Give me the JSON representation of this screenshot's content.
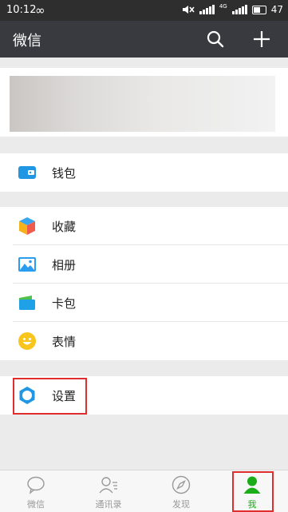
{
  "status_bar": {
    "time": "10:12",
    "network_label": "4G",
    "battery": "47"
  },
  "header": {
    "title": "微信"
  },
  "profile": {},
  "menu": {
    "wallet": "钱包",
    "favorites": "收藏",
    "album": "相册",
    "cards": "卡包",
    "stickers": "表情",
    "settings": "设置"
  },
  "tabs": {
    "chats": "微信",
    "contacts": "通讯录",
    "discover": "发现",
    "me": "我"
  },
  "colors": {
    "accent": "#1aad19",
    "header": "#393a3f",
    "highlight": "#e02e2e"
  }
}
